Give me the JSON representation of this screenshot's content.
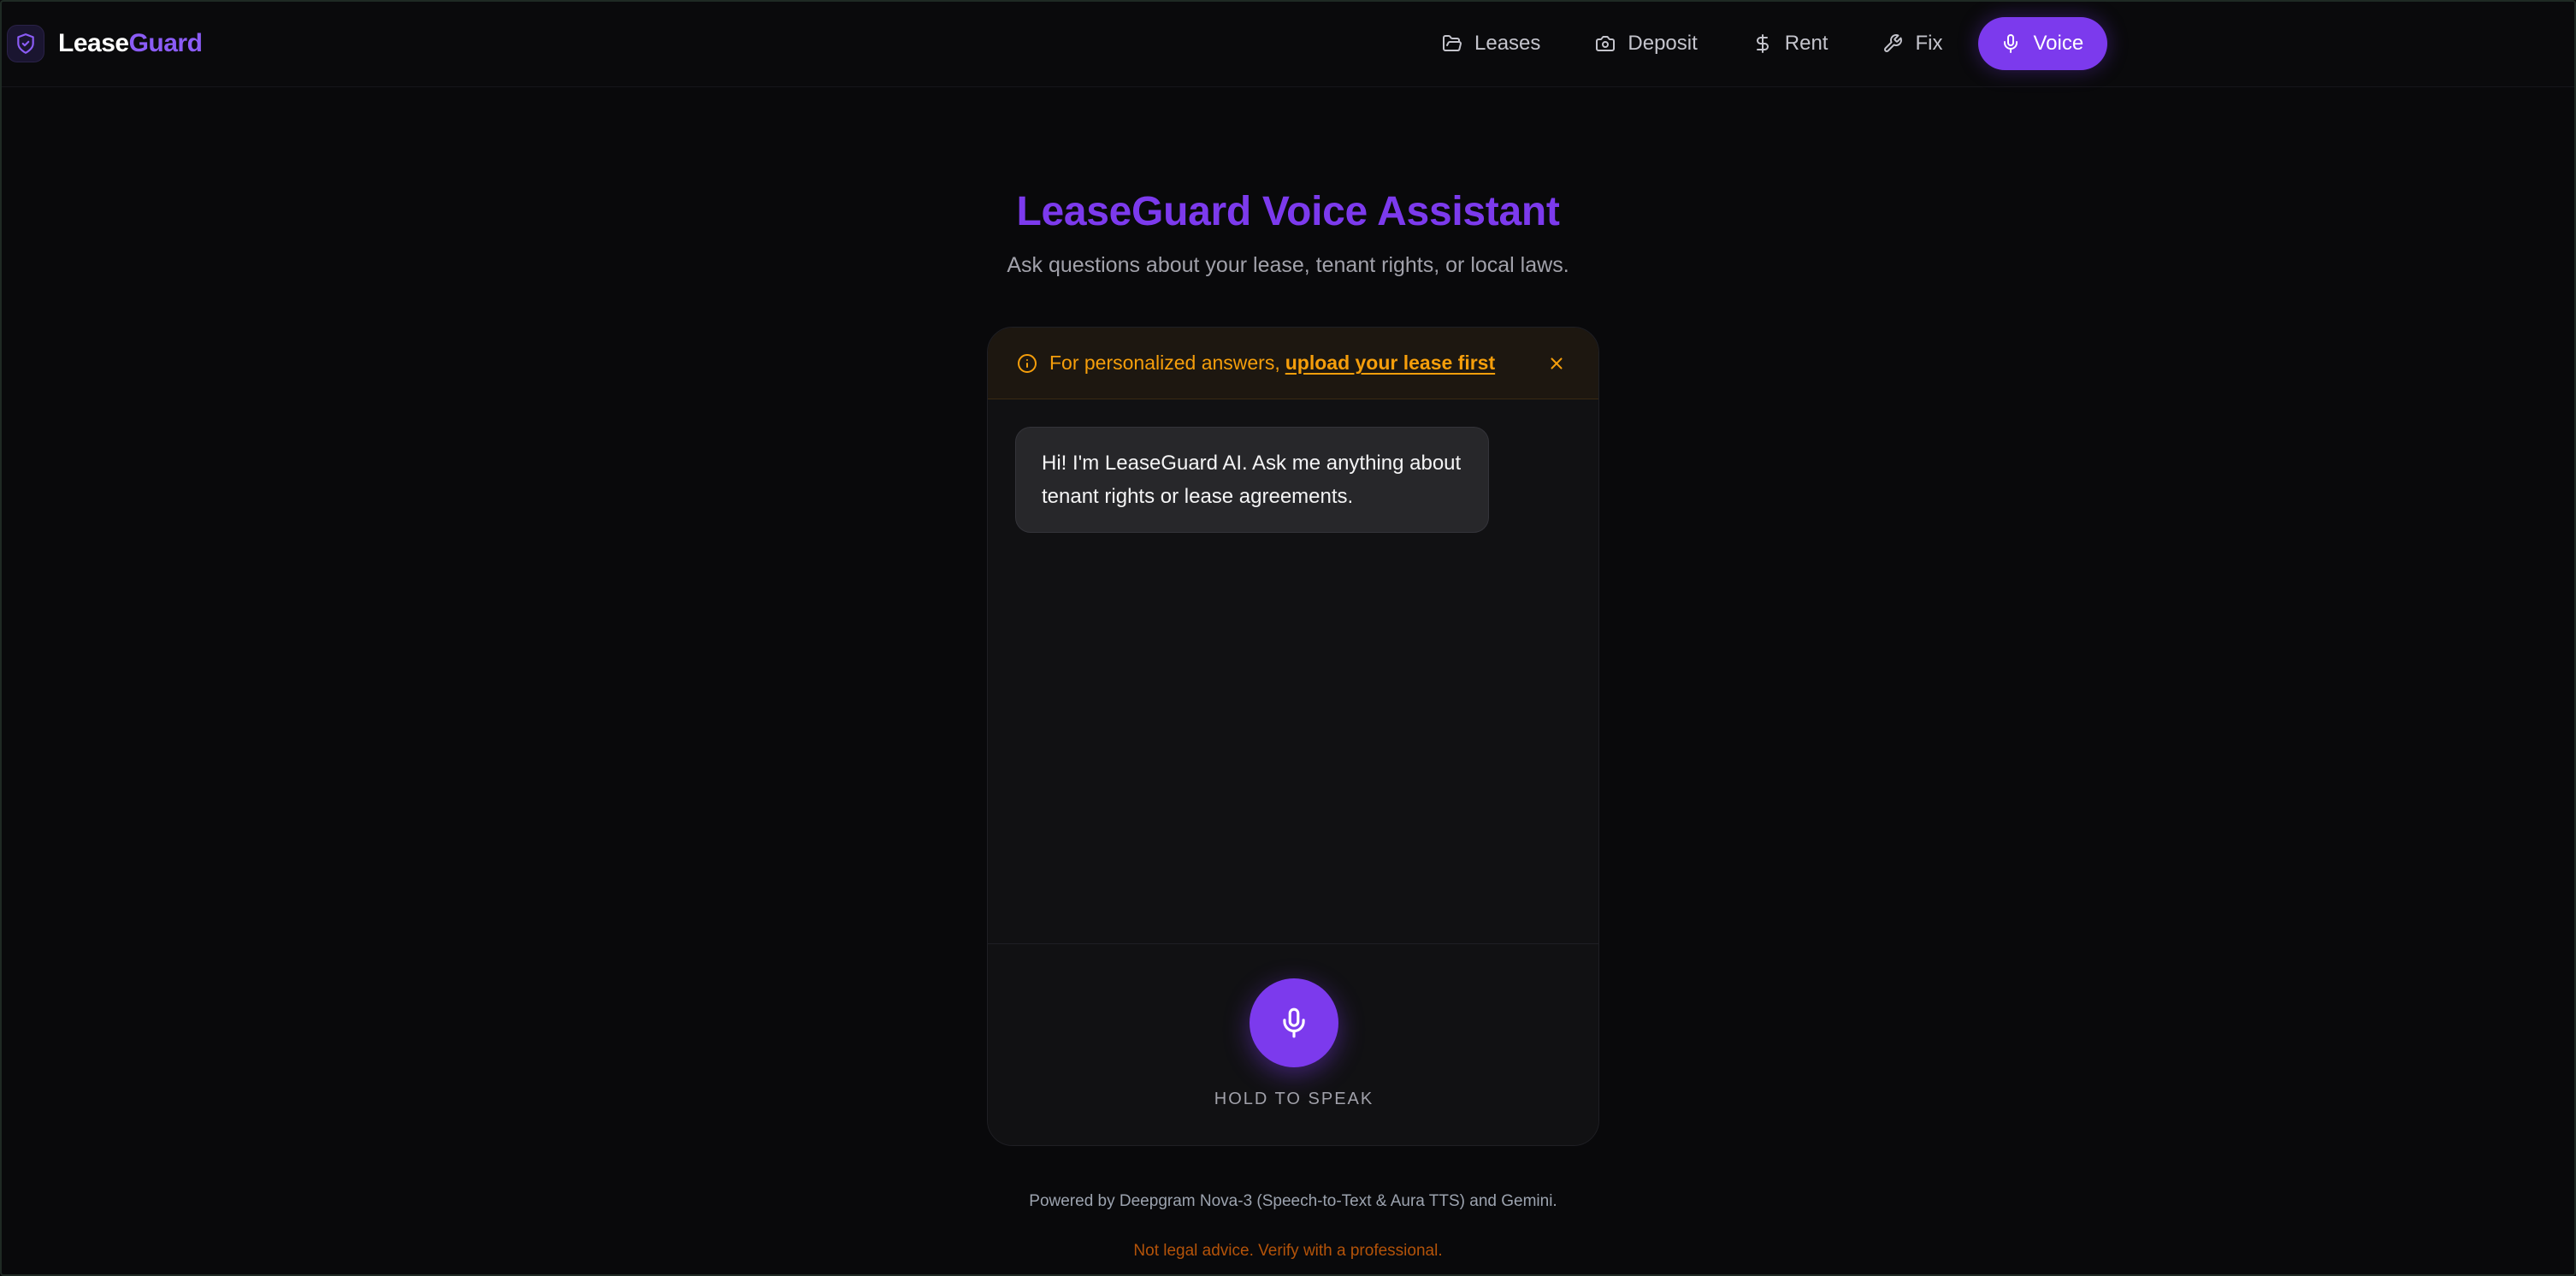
{
  "brand": {
    "name_part1": "Lease",
    "name_part2": "Guard",
    "icon": "shield-check-icon"
  },
  "nav": {
    "items": [
      {
        "label": "Leases",
        "icon": "folder-open-icon"
      },
      {
        "label": "Deposit",
        "icon": "camera-icon"
      },
      {
        "label": "Rent",
        "icon": "dollar-icon"
      },
      {
        "label": "Fix",
        "icon": "wrench-icon"
      },
      {
        "label": "Voice",
        "icon": "mic-icon",
        "active": true
      }
    ]
  },
  "page": {
    "title": "LeaseGuard Voice Assistant",
    "subtitle": "Ask questions about your lease, tenant rights, or local laws."
  },
  "banner": {
    "text": "For personalized answers,",
    "link": "upload your lease first",
    "icon": "info-icon",
    "close_icon": "close-icon"
  },
  "chat": {
    "messages": [
      {
        "role": "assistant",
        "text": "Hi! I'm LeaseGuard AI. Ask me anything about tenant rights or lease agreements."
      }
    ]
  },
  "controls": {
    "mic_icon": "mic-icon",
    "hold_label": "HOLD TO SPEAK"
  },
  "footer": {
    "powered_by": "Powered by Deepgram Nova-3 (Speech-to-Text & Aura TTS) and Gemini.",
    "disclaimer": "Not legal advice. Verify with a professional."
  },
  "colors": {
    "accent": "#7c3aed",
    "background": "#09090b",
    "warning": "#f59e0b"
  }
}
